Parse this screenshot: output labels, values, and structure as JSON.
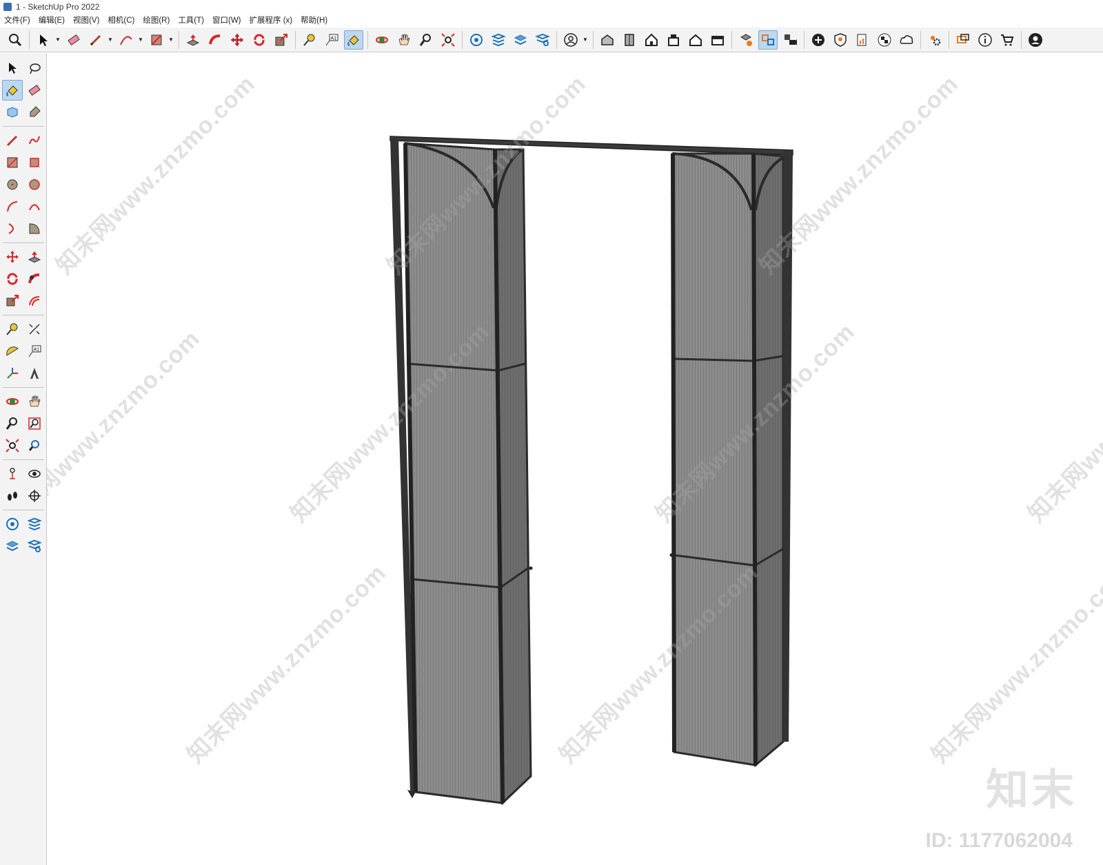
{
  "window": {
    "title": "1 - SketchUp Pro 2022"
  },
  "menu": {
    "items": [
      "文件(F)",
      "编辑(E)",
      "视图(V)",
      "相机(C)",
      "绘图(R)",
      "工具(T)",
      "窗口(W)",
      "扩展程序 (x)",
      "帮助(H)"
    ]
  },
  "toolbar": {
    "icons": [
      "zoom-icon",
      "select-icon",
      "eraser-icon",
      "pencil-icon",
      "arc-icon",
      "rectangle-icon",
      "push-pull-icon",
      "follow-me-icon",
      "move-icon",
      "rotate-icon",
      "scale-icon",
      "tape-measure-icon",
      "text-icon",
      "paint-bucket-icon",
      "orbit-icon",
      "pan-icon",
      "zoom-tool-icon",
      "zoom-extents-icon",
      "warehouse-icon",
      "extension-icon",
      "layers-icon",
      "settings-icon",
      "profile-icon",
      "iso-view-icon",
      "top-view-icon",
      "home-view-icon",
      "front-view-icon",
      "right-view-icon",
      "back-view-icon",
      "component-icon",
      "swap-icon",
      "scene-icon",
      "add-icon",
      "shield-icon",
      "report-icon",
      "checker-icon",
      "cloud-icon",
      "gears-icon",
      "chat-icon",
      "info-icon",
      "cart-icon",
      "account-icon"
    ],
    "active": "paint-bucket-icon"
  },
  "sidebar": {
    "active": "paint-bucket-icon"
  },
  "watermark": {
    "text": "知末网www.znzmo.com",
    "brand": "知末",
    "id": "ID: 1177062004"
  },
  "colors": {
    "frame": "#333333",
    "panel": "#8c8c8c",
    "panel_dark": "#6e6e6e",
    "accent_red": "#d9262b",
    "active_bg": "#bcd8f0"
  }
}
